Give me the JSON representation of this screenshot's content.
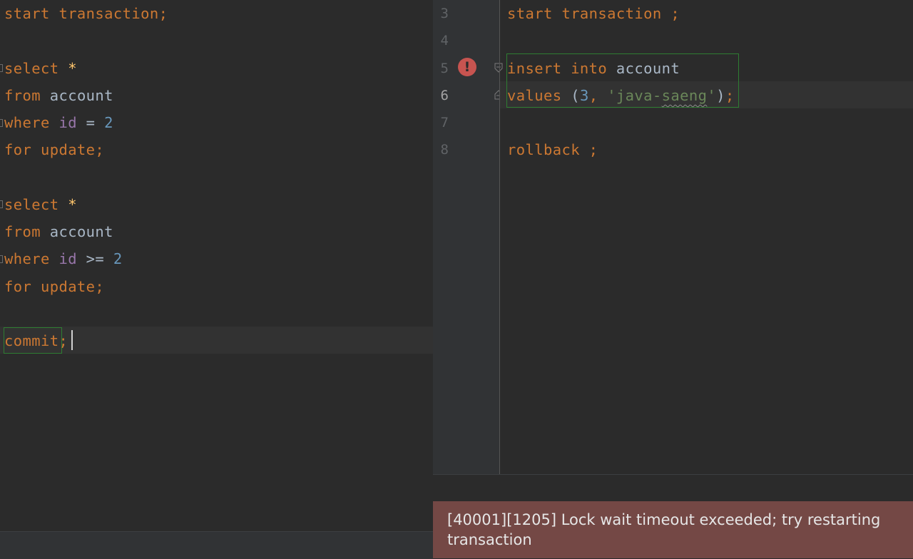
{
  "left_editor": {
    "lines": [
      [
        {
          "t": "start transaction;",
          "c": "kw"
        }
      ],
      [],
      [
        {
          "t": "select ",
          "c": "kw"
        },
        {
          "t": "*",
          "c": "star"
        }
      ],
      [
        {
          "t": "from ",
          "c": "kw"
        },
        {
          "t": "account",
          "c": "id"
        }
      ],
      [
        {
          "t": "where ",
          "c": "kw"
        },
        {
          "t": "id",
          "c": "col"
        },
        {
          "t": " = ",
          "c": "id"
        },
        {
          "t": "2",
          "c": "num"
        }
      ],
      [
        {
          "t": "for update;",
          "c": "kw"
        }
      ],
      [],
      [
        {
          "t": "select ",
          "c": "kw"
        },
        {
          "t": "*",
          "c": "star"
        }
      ],
      [
        {
          "t": "from ",
          "c": "kw"
        },
        {
          "t": "account",
          "c": "id"
        }
      ],
      [
        {
          "t": "where ",
          "c": "kw"
        },
        {
          "t": "id",
          "c": "col"
        },
        {
          "t": " >= ",
          "c": "id"
        },
        {
          "t": "2",
          "c": "num"
        }
      ],
      [
        {
          "t": "for update;",
          "c": "kw"
        }
      ],
      [],
      [
        {
          "t": "commit",
          "c": "kw"
        },
        {
          "t": ";",
          "c": "kw"
        }
      ]
    ]
  },
  "right_editor": {
    "line_numbers": [
      "3",
      "4",
      "5",
      "6",
      "7",
      "8"
    ],
    "active_line_number": "6",
    "error_icon": "exclamation-error-icon",
    "error_icon_glyph": "!",
    "lines": [
      [
        {
          "t": "start transaction ;",
          "c": "kw"
        }
      ],
      [],
      [
        {
          "t": "insert into ",
          "c": "kw"
        },
        {
          "t": "account",
          "c": "id"
        }
      ],
      [
        {
          "t": "values ",
          "c": "kw"
        },
        {
          "t": "(",
          "c": "id"
        },
        {
          "t": "3",
          "c": "num"
        },
        {
          "t": ", ",
          "c": "kw"
        },
        {
          "t": "'java-",
          "c": "str"
        },
        {
          "t": "saeng",
          "c": "str",
          "w": true
        },
        {
          "t": "'",
          "c": "str"
        },
        {
          "t": ")",
          "c": "id"
        },
        {
          "t": ";",
          "c": "kw"
        }
      ],
      [],
      [
        {
          "t": "rollback ;",
          "c": "kw"
        }
      ]
    ]
  },
  "error_message": "[40001][1205] Lock wait timeout exceeded; try restarting transaction",
  "colors": {
    "background": "#2b2b2b",
    "keyword": "#cc7832",
    "identifier": "#a9b7c6",
    "column": "#9876aa",
    "number": "#6897bb",
    "string": "#6a8759",
    "error_banner": "#744845",
    "error_icon": "#c75450"
  }
}
